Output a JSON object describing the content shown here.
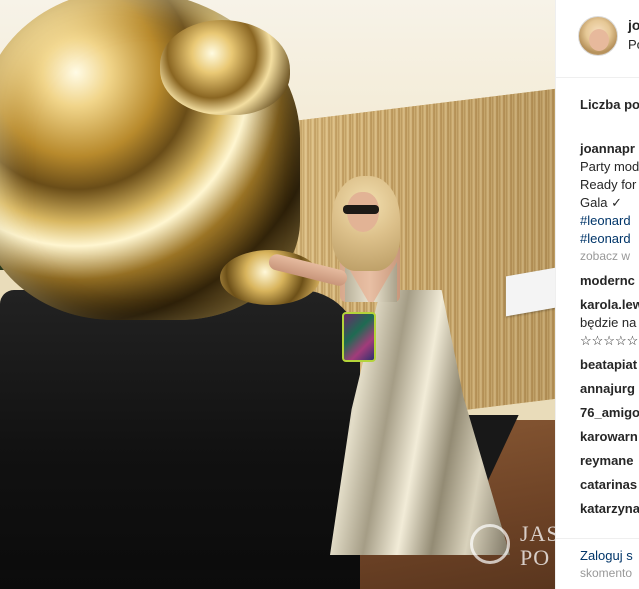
{
  "post": {
    "username": "jo",
    "location": "Po",
    "likes_label": "Liczba po",
    "caption": {
      "user": "joannapr",
      "lines": [
        "Party mod",
        "Ready for",
        "Gala ✓"
      ],
      "hashtags": [
        "#leonard",
        "#leonard"
      ]
    },
    "see_all_comments": "zobacz w",
    "comments": [
      {
        "user": "modernc",
        "text": ""
      },
      {
        "user": "karola.lew",
        "text": "będzie na",
        "extra": "☆☆☆☆☆"
      },
      {
        "user": "beatapiat",
        "text": ""
      },
      {
        "user": "annajurg",
        "text": ""
      },
      {
        "user": "76_amigo",
        "text": ""
      },
      {
        "user": "karowarn",
        "text": ""
      },
      {
        "user": "reymane",
        "text": ""
      },
      {
        "user": "catarinas",
        "text": ""
      },
      {
        "user": "katarzyna",
        "text": ""
      }
    ],
    "login_prompt": "Zaloguj s",
    "login_sub": "skomento"
  },
  "photo": {
    "watermark": "JAS\nPO",
    "watermark_line1": "JAS",
    "watermark_line2": "PO"
  },
  "colors": {
    "link": "#003569",
    "text": "#262626",
    "muted": "#999999",
    "border": "#efefef"
  },
  "icons": {
    "check": "✓",
    "stars": "☆"
  }
}
